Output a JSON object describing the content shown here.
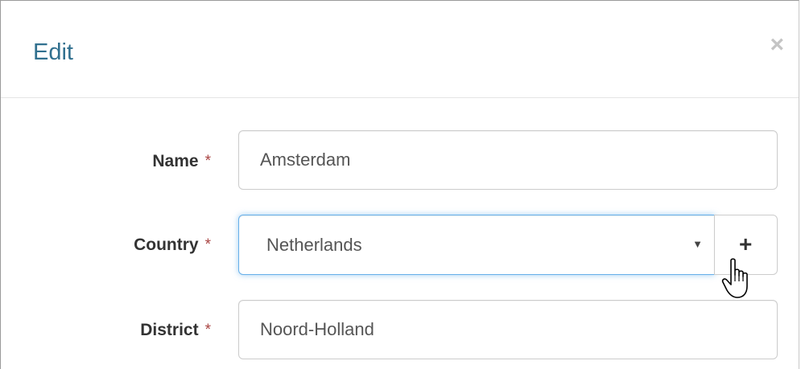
{
  "dialog": {
    "title": "Edit",
    "close_label": "×"
  },
  "form": {
    "required_marker": "*",
    "name": {
      "label": "Name",
      "value": "Amsterdam"
    },
    "country": {
      "label": "Country",
      "selected": "Netherlands",
      "caret": "▼",
      "add_label": "+"
    },
    "district": {
      "label": "District",
      "value": "Noord-Holland"
    }
  },
  "colors": {
    "title": "#31708f",
    "required": "#a94442",
    "focus_border": "#66afe9"
  },
  "icons": {
    "close": "close-icon",
    "dropdown": "chevron-down-icon",
    "add": "plus-icon",
    "cursor": "hand-pointer-icon"
  }
}
